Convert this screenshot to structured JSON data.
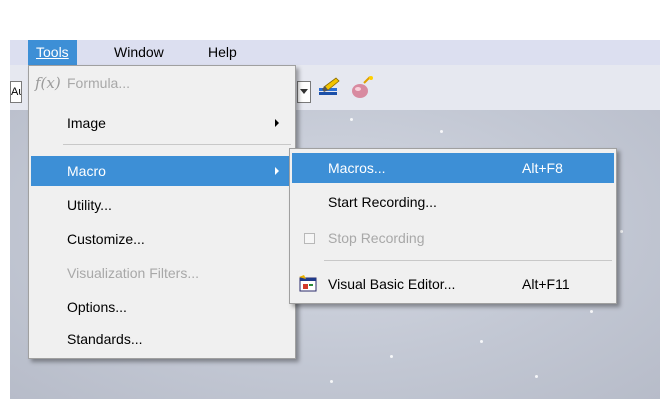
{
  "menubar": {
    "items": [
      {
        "label": "Tools",
        "active": true
      },
      {
        "label": "Window",
        "active": false
      },
      {
        "label": "Help",
        "active": false
      }
    ]
  },
  "toolbar": {
    "left_box_text": "Au",
    "icons": [
      "paint-brush-icon",
      "macro-ball-icon"
    ]
  },
  "tools_menu": {
    "items": [
      {
        "label": "Formula...",
        "icon": "fx-icon",
        "icon_text": "f(x)",
        "disabled": true,
        "submenu": false
      },
      {
        "label": "Image",
        "disabled": false,
        "submenu": true
      },
      {
        "label": "Macro",
        "disabled": false,
        "submenu": true,
        "selected": true
      },
      {
        "label": "Utility...",
        "disabled": false
      },
      {
        "label": "Customize...",
        "disabled": false
      },
      {
        "label": "Visualization Filters...",
        "disabled": true
      },
      {
        "label": "Options...",
        "disabled": false
      },
      {
        "label": "Standards...",
        "disabled": false
      }
    ]
  },
  "macro_submenu": {
    "items": [
      {
        "label": "Macros...",
        "shortcut": "Alt+F8",
        "selected": true
      },
      {
        "label": "Start Recording...",
        "shortcut": ""
      },
      {
        "label": "Stop Recording",
        "shortcut": "",
        "disabled": true,
        "icon": "checkbox-icon"
      },
      {
        "label": "Visual Basic Editor...",
        "shortcut": "Alt+F11",
        "icon": "vba-editor-icon"
      }
    ]
  },
  "colors": {
    "menubar_bg": "#dcdff0",
    "highlight": "#3d8fd6",
    "menu_bg": "#f0f0f0",
    "disabled_text": "#a8a8a8"
  }
}
